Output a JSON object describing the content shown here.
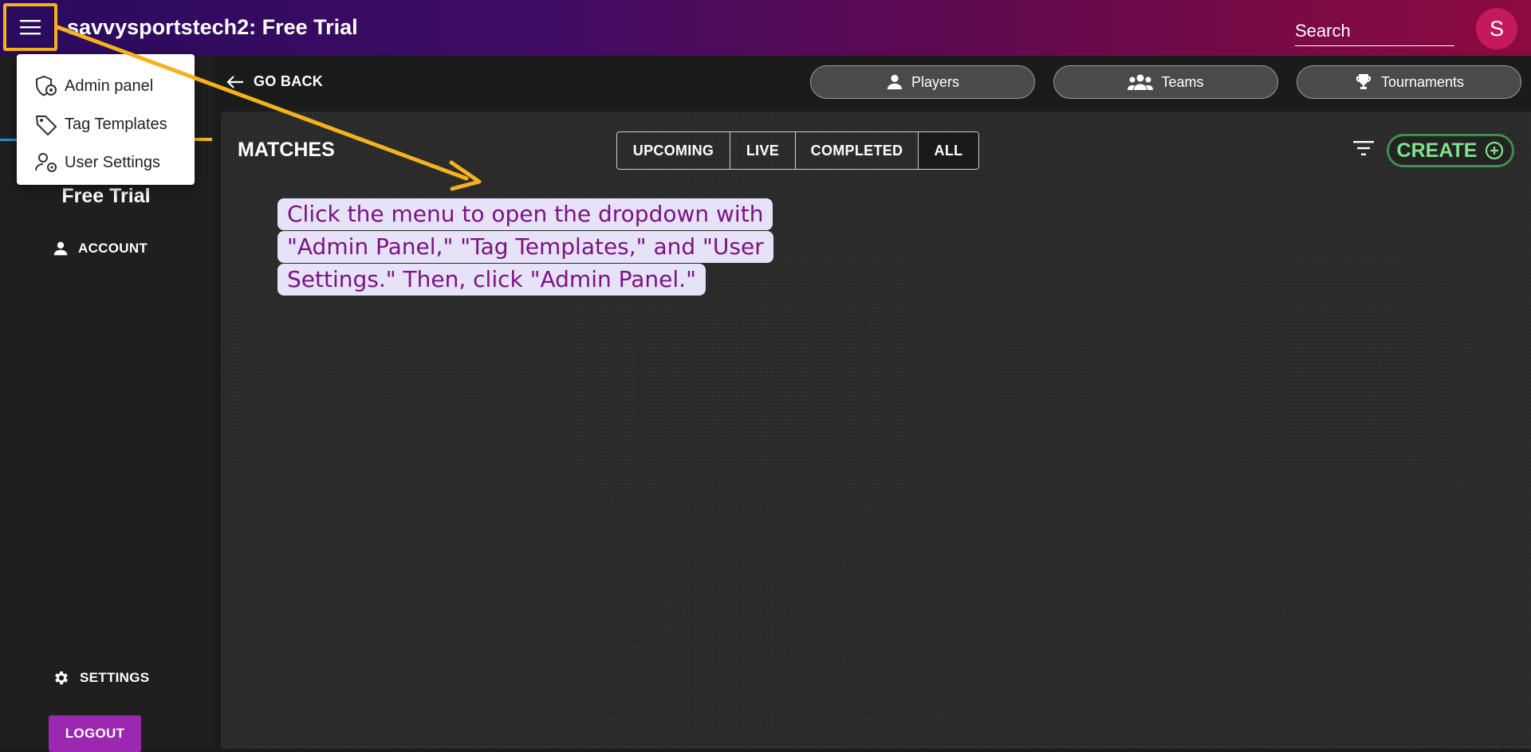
{
  "header": {
    "title": "savvysportstech2: Free Trial",
    "search_label": "Search",
    "avatar_letter": "S"
  },
  "menu": {
    "items": [
      {
        "label": "Admin panel",
        "icon": "shield-cog-icon"
      },
      {
        "label": "Tag Templates",
        "icon": "tag-icon"
      },
      {
        "label": "User Settings",
        "icon": "user-settings-icon"
      }
    ]
  },
  "sidebar": {
    "org_name": "Free Trial",
    "account_label": "ACCOUNT",
    "settings_label": "SETTINGS",
    "logout_label": "LOGOUT"
  },
  "toolbar": {
    "go_back_label": "GO BACK",
    "players_label": "Players",
    "teams_label": "Teams",
    "tournaments_label": "Tournaments"
  },
  "matches": {
    "title": "MATCHES",
    "tabs": [
      "UPCOMING",
      "LIVE",
      "COMPLETED",
      "ALL"
    ],
    "create_label": "CREATE"
  },
  "annotation": {
    "lines": [
      "Click the menu to open the dropdown with",
      "\"Admin Panel,\" \"Tag Templates,\" and \"User",
      "Settings.\" Then, click \"Admin Panel.\""
    ]
  },
  "colors": {
    "highlight": "#f6b21a",
    "create_green": "#7fe38a",
    "logout_purple": "#9c27b0",
    "avatar": "#c41a5b",
    "annotation_text": "#7b1383"
  }
}
